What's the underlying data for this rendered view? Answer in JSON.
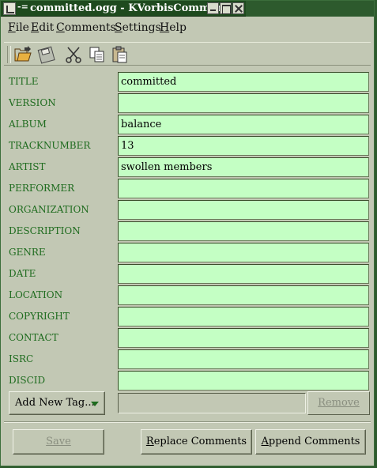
{
  "window": {
    "title": "committed.ogg - KVorbisComment",
    "menu_glyph": "-=",
    "title_icons": [
      "app-icon",
      "minimize-icon",
      "maximize-icon",
      "close-icon"
    ]
  },
  "menubar": {
    "items": [
      {
        "mnemonic": "F",
        "rest": "ile"
      },
      {
        "mnemonic": "E",
        "rest": "dit"
      },
      {
        "mnemonic": "C",
        "rest": "omments"
      },
      {
        "mnemonic": "S",
        "rest": "ettings"
      },
      {
        "mnemonic": "H",
        "rest": "elp"
      }
    ]
  },
  "toolbar": {
    "icons": [
      "open-folder-icon",
      "save-disk-icon",
      "cut-icon",
      "copy-icon",
      "paste-icon"
    ]
  },
  "fields": [
    {
      "label": "TITLE",
      "value": "committed"
    },
    {
      "label": "VERSION",
      "value": ""
    },
    {
      "label": "ALBUM",
      "value": "balance"
    },
    {
      "label": "TRACKNUMBER",
      "value": "13"
    },
    {
      "label": "ARTIST",
      "value": "swollen members"
    },
    {
      "label": "PERFORMER",
      "value": ""
    },
    {
      "label": "ORGANIZATION",
      "value": ""
    },
    {
      "label": "DESCRIPTION",
      "value": ""
    },
    {
      "label": "GENRE",
      "value": ""
    },
    {
      "label": "DATE",
      "value": ""
    },
    {
      "label": "LOCATION",
      "value": ""
    },
    {
      "label": "COPYRIGHT",
      "value": ""
    },
    {
      "label": "CONTACT",
      "value": ""
    },
    {
      "label": "ISRC",
      "value": ""
    },
    {
      "label": "DISCID",
      "value": ""
    }
  ],
  "tag_controls": {
    "add_label": "Add New Tag...",
    "new_tag_value": "",
    "remove_label": "Remove"
  },
  "buttons": {
    "save_label": "Save",
    "replace": {
      "mnemonic": "R",
      "rest": "eplace Comments"
    },
    "append": {
      "mnemonic": "A",
      "rest": "ppend Comments"
    }
  },
  "colors": {
    "window_bg": "#c2c8b4",
    "field_bg": "#c4ffc4",
    "label_green": "#1e6b1e",
    "titlebar": "#1e4a1e"
  }
}
